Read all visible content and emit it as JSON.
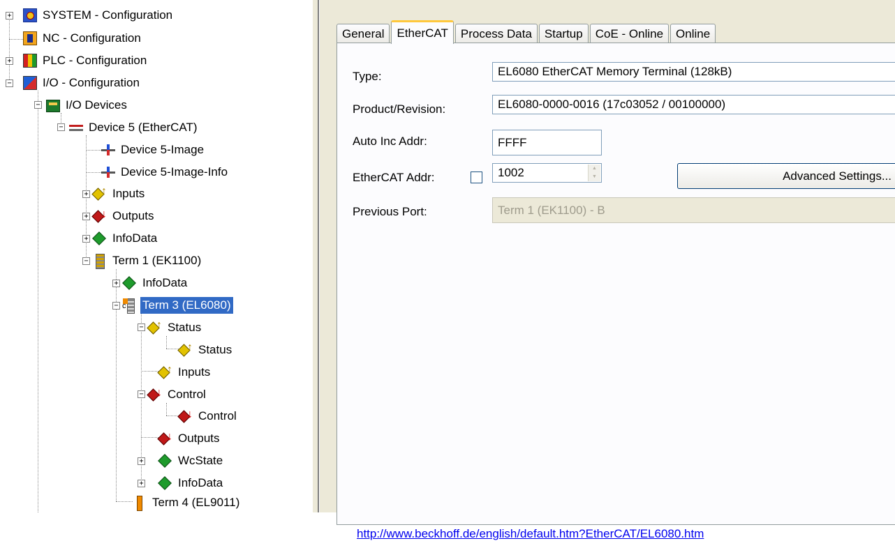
{
  "tree": {
    "system": "SYSTEM - Configuration",
    "nc": "NC - Configuration",
    "plc": "PLC - Configuration",
    "io": "I/O - Configuration",
    "io_devices": "I/O Devices",
    "device5": "Device 5 (EtherCAT)",
    "device5_image": "Device 5-Image",
    "device5_image_info": "Device 5-Image-Info",
    "inputs": "Inputs",
    "outputs": "Outputs",
    "infodata": "InfoData",
    "term1": "Term 1 (EK1100)",
    "term1_infodata": "InfoData",
    "term3": "Term 3 (EL6080)",
    "term3_marker": "c",
    "status_group": "Status",
    "status": "Status",
    "term3_inputs": "Inputs",
    "control_group": "Control",
    "control": "Control",
    "term3_outputs": "Outputs",
    "wcstate": "WcState",
    "term3_infodata": "InfoData",
    "term4": "Term 4 (EL9011)"
  },
  "tabs": [
    "General",
    "EtherCAT",
    "Process Data",
    "Startup",
    "CoE - Online",
    "Online"
  ],
  "active_tab": "EtherCAT",
  "form": {
    "type_label": "Type:",
    "type_value": "EL6080 EtherCAT Memory Terminal (128kB)",
    "product_label": "Product/Revision:",
    "product_value": "EL6080-0000-0016 (17c03052 / 00100000)",
    "autoinc_label": "Auto Inc Addr:",
    "autoinc_value": "FFFF",
    "ecataddr_label": "EtherCAT Addr:",
    "ecataddr_value": "1002",
    "ecataddr_checked": false,
    "advanced_button": "Advanced Settings...",
    "prevport_label": "Previous Port:",
    "prevport_value": "Term 1 (EK1100) - B"
  },
  "link": "http://www.beckhoff.de/english/default.htm?EtherCAT/EL6080.htm"
}
